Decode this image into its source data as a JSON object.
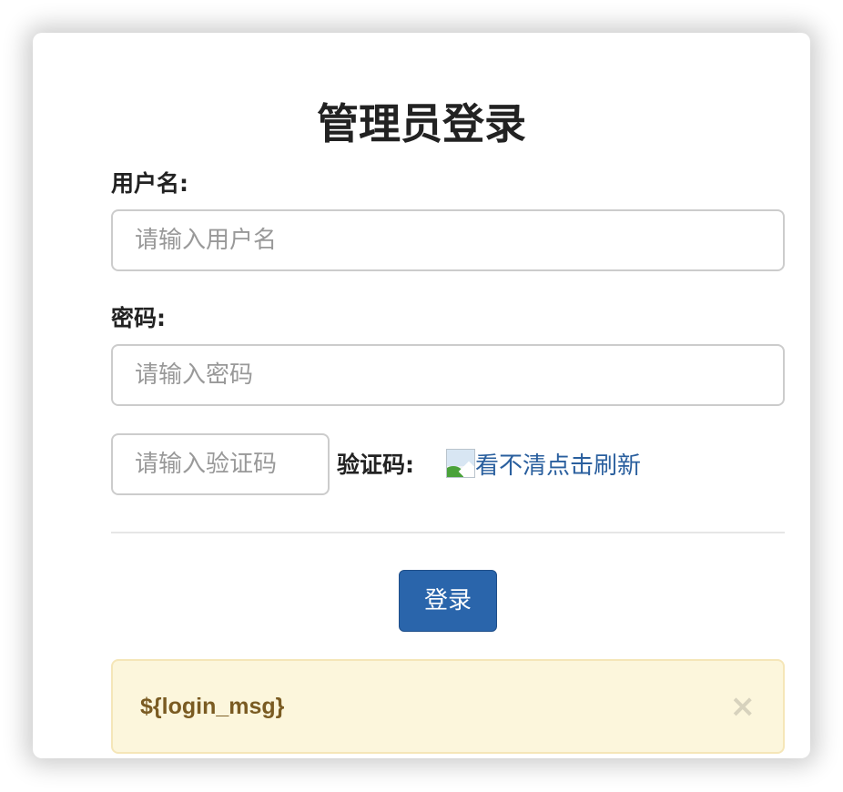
{
  "login": {
    "title": "管理员登录",
    "username_label": "用户名:",
    "username_placeholder": "请输入用户名",
    "password_label": "密码:",
    "password_placeholder": "请输入密码",
    "captcha_placeholder": "请输入验证码",
    "captcha_label": "验证码:",
    "captcha_refresh_text": "看不清点击刷新",
    "submit_label": "登录"
  },
  "alert": {
    "message": "${login_msg}",
    "close_symbol": "×"
  },
  "colors": {
    "primary": "#2a65ab",
    "link": "#2a5f9e",
    "alert_bg": "#fcf6dc",
    "alert_text": "#7a5b22"
  }
}
